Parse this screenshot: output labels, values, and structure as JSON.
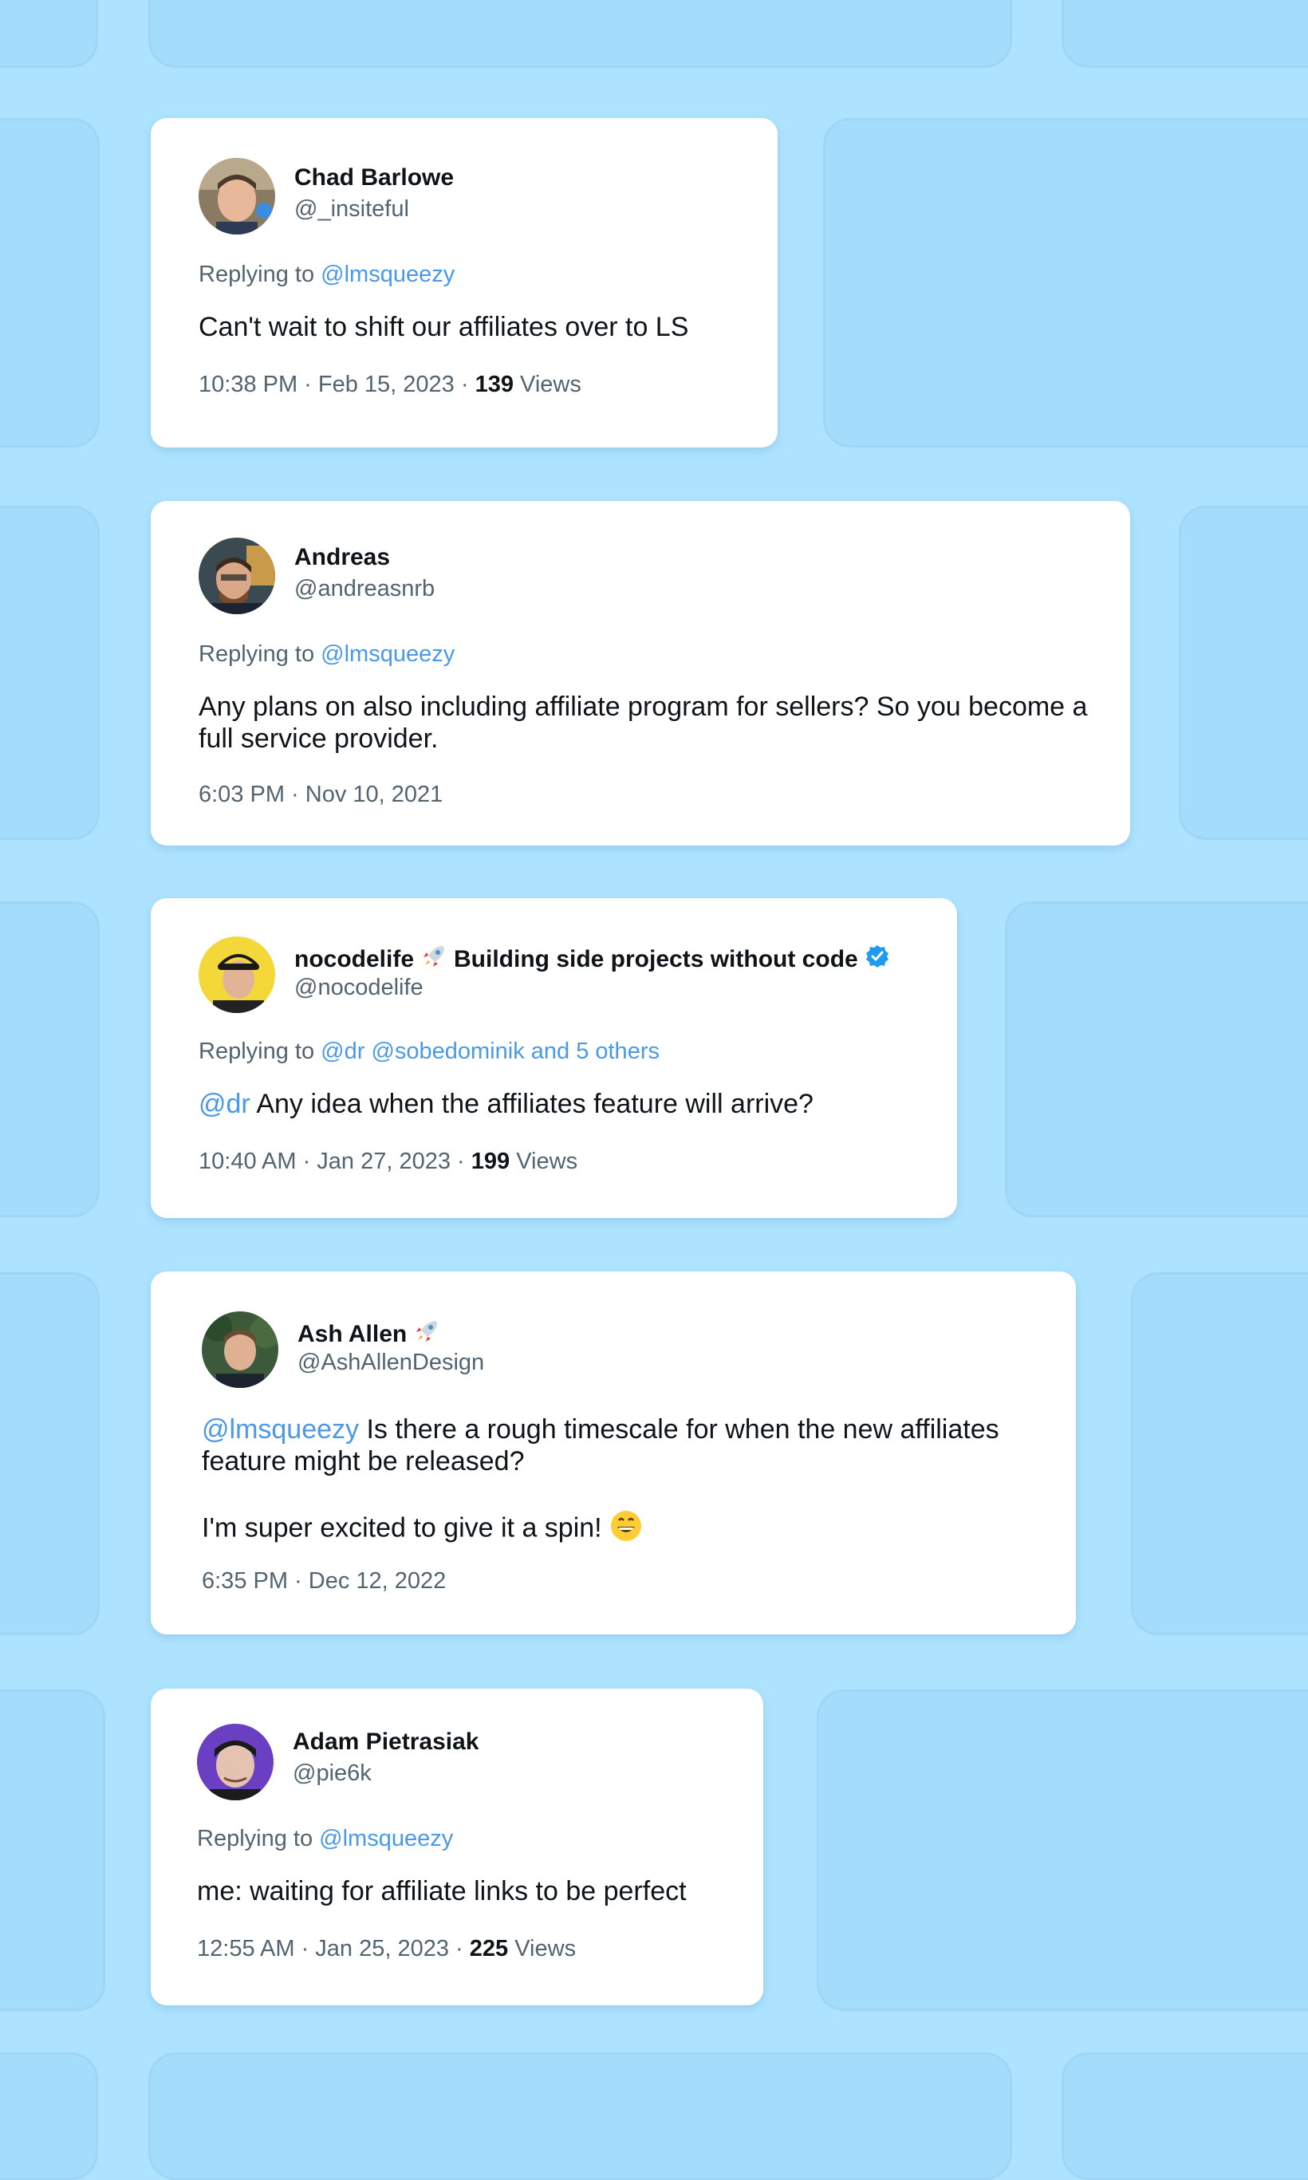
{
  "tweets": [
    {
      "name": "Chad Barlowe",
      "handle": "@_insiteful",
      "replying_prefix": "Replying to",
      "replying_to": "@lmsqueezy",
      "text": "Can't wait to shift our affiliates over to LS",
      "time": "10:38 PM · Feb 15, 2023 ·",
      "views_count": "139",
      "views_label": "Views"
    },
    {
      "name": "Andreas",
      "handle": "@andreasnrb",
      "replying_prefix": "Replying to",
      "replying_to": "@lmsqueezy",
      "text": "Any plans on also including affiliate program for sellers? So you become a full service provider.",
      "time": "6:03 PM · Nov 10, 2021"
    },
    {
      "name_part1": "nocodelife",
      "name_part2": "Building side projects without code",
      "handle": "@nocodelife",
      "replying_prefix": "Replying to",
      "replying_to": "@dr @sobedominik and 5 others",
      "mention": "@dr",
      "text": " Any idea when the affiliates feature will arrive?",
      "time": "10:40 AM · Jan 27, 2023 ·",
      "views_count": "199",
      "views_label": "Views"
    },
    {
      "name": "Ash Allen",
      "handle": "@AshAllenDesign",
      "mention": "@lmsqueezy",
      "text": " Is there a rough timescale for when the new affiliates feature might be released?",
      "text2": "I'm super excited to give it a spin!",
      "time": "6:35 PM · Dec 12, 2022"
    },
    {
      "name": "Adam Pietrasiak",
      "handle": "@pie6k",
      "replying_prefix": "Replying to",
      "replying_to": "@lmsqueezy",
      "text": "me: waiting for affiliate links to be perfect",
      "time": "12:55 AM · Jan 25, 2023 ·",
      "views_count": "225",
      "views_label": "Views"
    }
  ],
  "colors": {
    "background": "#ade3fe",
    "card": "#ffffff",
    "link": "#4a99e9",
    "muted": "#536471",
    "verified": "#1d9bf0"
  }
}
